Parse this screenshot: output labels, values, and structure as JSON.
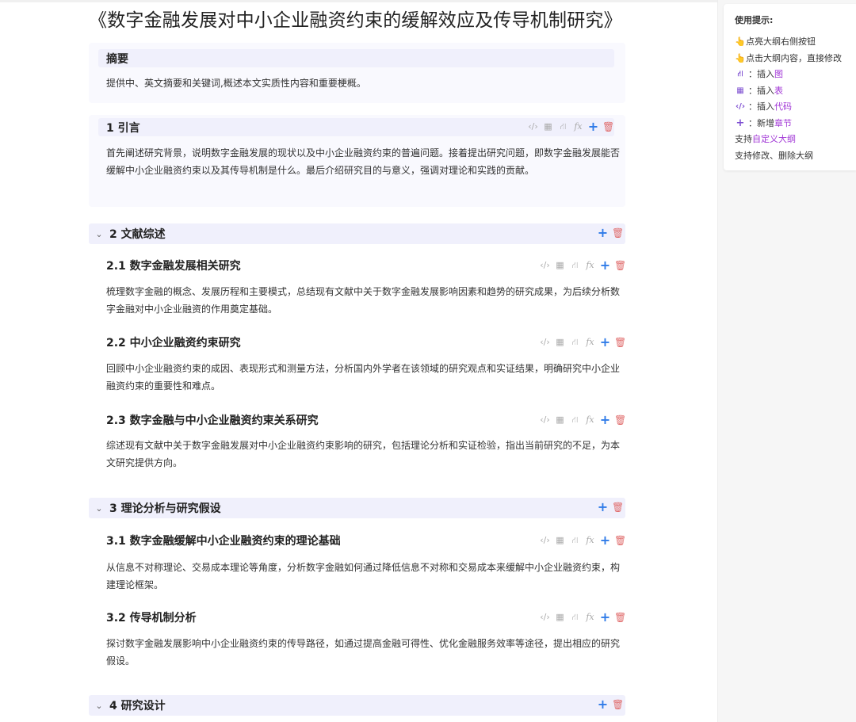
{
  "doc_title": "《数字金融发展对中小企业融资约束的缓解效应及传导机制研究》",
  "abstract": {
    "title": "摘要",
    "text": "提供中、英文摘要和关键词,概述本文实质性内容和重要梗概。"
  },
  "intro": {
    "title": "1 引言",
    "text": "首先阐述研究背景，说明数字金融发展的现状以及中小企业融资约束的普遍问题。接着提出研究问题，即数字金融发展能否缓解中小企业融资约束以及其传导机制是什么。最后介绍研究目的与意义，强调对理论和实践的贡献。"
  },
  "sections": [
    {
      "title": "2 文献综述",
      "subs": [
        {
          "title": "2.1 数字金融发展相关研究",
          "text": "梳理数字金融的概念、发展历程和主要模式，总结现有文献中关于数字金融发展影响因素和趋势的研究成果，为后续分析数字金融对中小企业融资的作用奠定基础。"
        },
        {
          "title": "2.2 中小企业融资约束研究",
          "text": "回顾中小企业融资约束的成因、表现形式和测量方法，分析国内外学者在该领域的研究观点和实证结果，明确研究中小企业融资约束的重要性和难点。"
        },
        {
          "title": "2.3 数字金融与中小企业融资约束关系研究",
          "text": "综述现有文献中关于数字金融发展对中小企业融资约束影响的研究，包括理论分析和实证检验，指出当前研究的不足，为本文研究提供方向。"
        }
      ]
    },
    {
      "title": "3 理论分析与研究假设",
      "subs": [
        {
          "title": "3.1 数字金融缓解中小企业融资约束的理论基础",
          "text": "从信息不对称理论、交易成本理论等角度，分析数字金融如何通过降低信息不对称和交易成本来缓解中小企业融资约束，构建理论框架。"
        },
        {
          "title": "3.2 传导机制分析",
          "text": "探讨数字金融发展影响中小企业融资约束的传导路径，如通过提高金融可得性、优化金融服务效率等途径，提出相应的研究假设。"
        }
      ]
    },
    {
      "title": "4 研究设计",
      "subs": []
    }
  ],
  "tools": {
    "code": "‹/›",
    "table": "▦",
    "chart": "⛙",
    "formula": "fx",
    "add": "+",
    "delete": "🗑"
  },
  "chevron": "⌄",
  "tips": {
    "title": "使用提示:",
    "rows": [
      {
        "icon": "👆",
        "pre": "点亮大纲右侧按钮",
        "hl": "",
        "post": ""
      },
      {
        "icon": "👆",
        "pre": "点击大纲内容，直接修改",
        "hl": "",
        "post": ""
      },
      {
        "icon": "⛙",
        "pre": "：插入",
        "hl": "图",
        "post": ""
      },
      {
        "icon": "▦",
        "pre": "：插入",
        "hl": "表",
        "post": ""
      },
      {
        "icon": "‹/›",
        "pre": "：插入",
        "hl": "代码",
        "post": ""
      },
      {
        "icon": "+",
        "pre": "：新增",
        "hl": "章节",
        "post": ""
      },
      {
        "icon": "",
        "pre": "支持",
        "hl": "自定义大纲",
        "post": ""
      },
      {
        "icon": "",
        "pre": "支持修改、删除大纲",
        "hl": "",
        "post": ""
      }
    ]
  }
}
